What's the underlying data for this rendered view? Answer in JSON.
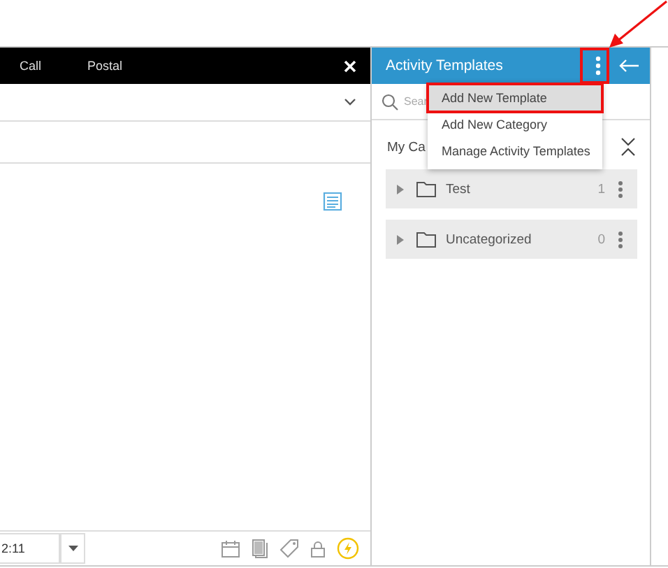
{
  "editor": {
    "tabs": [
      {
        "label": "Call"
      },
      {
        "label": "Postal"
      }
    ],
    "time_field": {
      "value": "2:11"
    }
  },
  "templates_panel": {
    "title": "Activity Templates",
    "search": {
      "placeholder": "Sear"
    },
    "section_label": "My Ca",
    "categories": [
      {
        "name": "Test",
        "count": "1"
      },
      {
        "name": "Uncategorized",
        "count": "0"
      }
    ]
  },
  "menu": {
    "items": [
      {
        "label": "Add New Template",
        "selected": true
      },
      {
        "label": "Add New Category",
        "selected": false
      },
      {
        "label": "Manage Activity Templates",
        "selected": false
      }
    ]
  }
}
